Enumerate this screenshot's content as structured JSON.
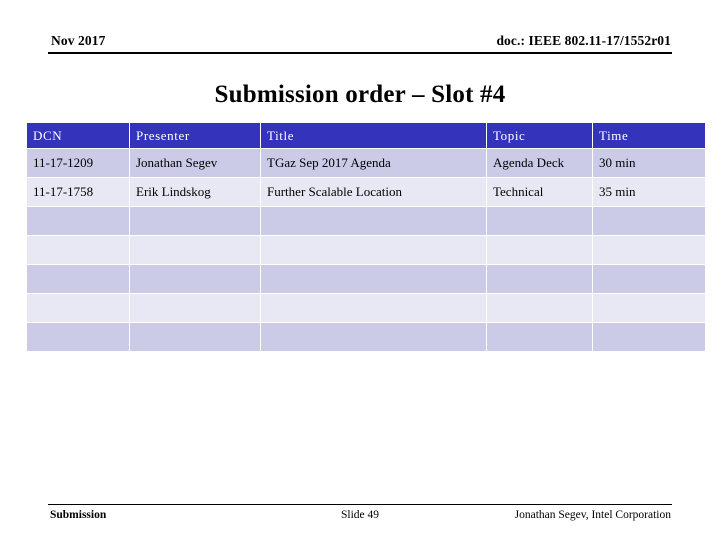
{
  "header": {
    "date": "Nov 2017",
    "doc": "doc.: IEEE 802.11-17/1552r01"
  },
  "title": "Submission order – Slot #4",
  "table": {
    "columns": [
      "DCN",
      "Presenter",
      "Title",
      "Topic",
      "Time"
    ],
    "rows": [
      {
        "dcn": "11-17-1209",
        "presenter": "Jonathan Segev",
        "title": "TGaz Sep 2017 Agenda",
        "topic": "Agenda Deck",
        "time": "30 min"
      },
      {
        "dcn": "11-17-1758",
        "presenter": "Erik Lindskog",
        "title": "Further Scalable Location",
        "topic": "Technical",
        "time": "35 min"
      },
      {
        "dcn": "",
        "presenter": "",
        "title": "",
        "topic": "",
        "time": ""
      },
      {
        "dcn": "",
        "presenter": "",
        "title": "",
        "topic": "",
        "time": ""
      },
      {
        "dcn": "",
        "presenter": "",
        "title": "",
        "topic": "",
        "time": ""
      },
      {
        "dcn": "",
        "presenter": "",
        "title": "",
        "topic": "",
        "time": ""
      },
      {
        "dcn": "",
        "presenter": "",
        "title": "",
        "topic": "",
        "time": ""
      }
    ]
  },
  "footer": {
    "left": "Submission",
    "center": "Slide 49",
    "right": "Jonathan Segev, Intel Corporation"
  },
  "colors": {
    "header_blue": "#3333BB",
    "row_dark": "#CBCBE8",
    "row_light": "#E8E8F5"
  }
}
